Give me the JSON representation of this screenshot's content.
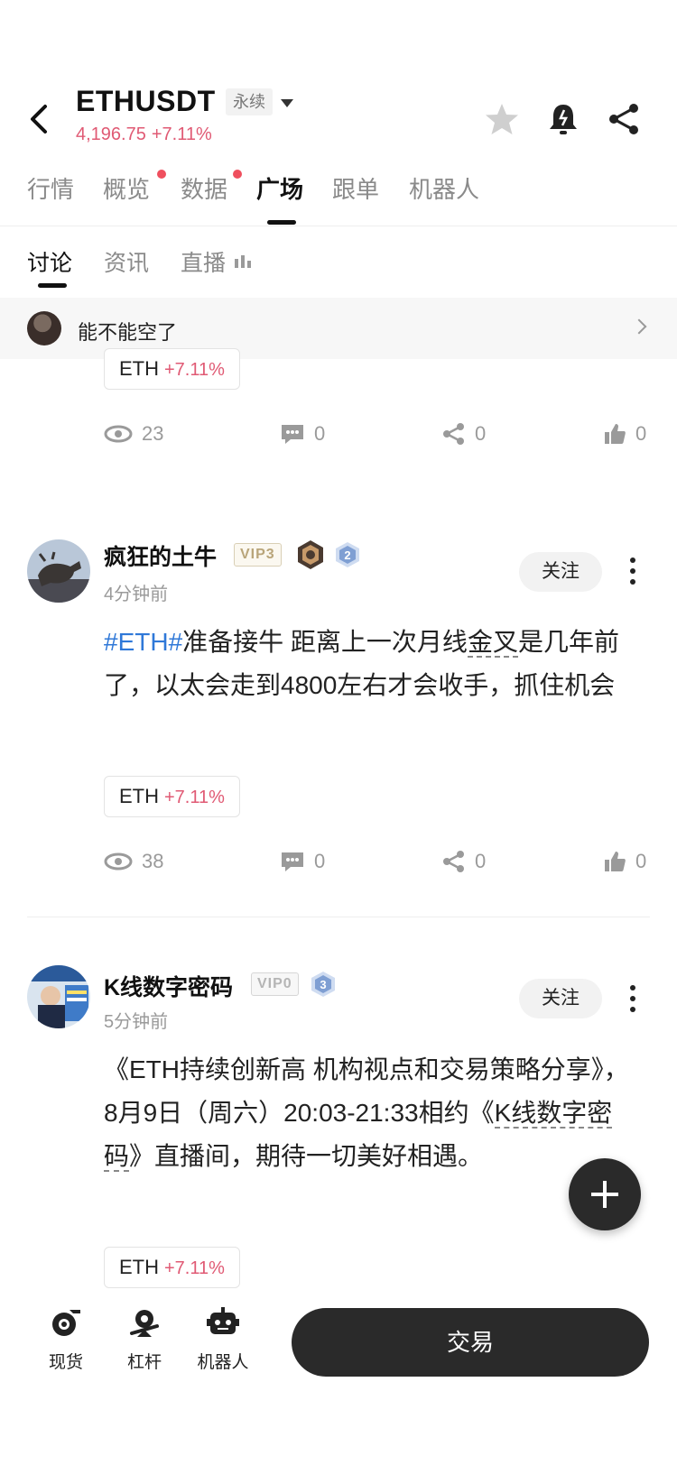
{
  "header": {
    "symbol": "ETHUSDT",
    "contract_type": "永续",
    "price": "4,196.75",
    "change": "+7.11%"
  },
  "main_tabs": [
    {
      "label": "行情",
      "dot": false
    },
    {
      "label": "概览",
      "dot": true
    },
    {
      "label": "数据",
      "dot": true
    },
    {
      "label": "广场",
      "dot": false,
      "active": true
    },
    {
      "label": "跟单",
      "dot": false
    },
    {
      "label": "机器人",
      "dot": false
    }
  ],
  "sub_tabs": [
    {
      "label": "讨论",
      "active": true
    },
    {
      "label": "资讯"
    },
    {
      "label": "直播"
    }
  ],
  "notice": {
    "text": "能不能空了"
  },
  "prev_post": {
    "chip": {
      "coin": "ETH",
      "change": "+7.11%"
    },
    "stats": {
      "views": "23",
      "comments": "0",
      "shares": "0",
      "likes": "0"
    }
  },
  "posts": [
    {
      "username": "疯狂的土牛",
      "vip": "VIP3",
      "level": "2",
      "time": "4分钟前",
      "follow": "关注",
      "hashtag": "#ETH#",
      "text_a": "准备接牛 距离上一次月线",
      "text_b": "金叉",
      "text_c": "是几年前了，以太会走到4800左右才会收手，抓住机会",
      "chip": {
        "coin": "ETH",
        "change": "+7.11%"
      },
      "stats": {
        "views": "38",
        "comments": "0",
        "shares": "0",
        "likes": "0"
      }
    },
    {
      "username": "K线数字密码",
      "vip": "VIP0",
      "level": "3",
      "time": "5分钟前",
      "follow": "关注",
      "text_a": "《ETH持续创新高  机构视点和交易策略分享》，8月9日（周六）20:03-21:33相约《",
      "text_b": "K线数字密码",
      "text_c": "》直播间，期待一切美好相遇。",
      "chip": {
        "coin": "ETH",
        "change": "+7.11%"
      }
    }
  ],
  "bottom_nav": [
    {
      "label": "现货",
      "icon": "spot-icon"
    },
    {
      "label": "杠杆",
      "icon": "leverage-icon"
    },
    {
      "label": "机器人",
      "icon": "robot-icon"
    }
  ],
  "trade_button": "交易",
  "colors": {
    "accent_red": "#e05a74",
    "link_blue": "#2f78d8",
    "dark": "#2a2a2a"
  }
}
